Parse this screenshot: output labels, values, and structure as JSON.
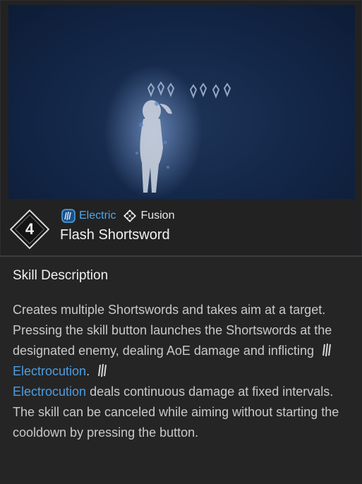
{
  "skill": {
    "level": "4",
    "name": "Flash Shortsword",
    "tags": [
      {
        "label": "Electric",
        "icon": "electric-icon",
        "color": "#4fa6ea"
      },
      {
        "label": "Fusion",
        "icon": "fusion-icon",
        "color": "#e8e8e8"
      }
    ]
  },
  "description": {
    "title": "Skill Description",
    "p1_a": "Creates multiple Shortswords and takes aim at a target. Pressing the skill button launches the Shortswords at the designated enemy, dealing AoE damage and inflicting",
    "kw1": "Electrocution",
    "p1_b": ".",
    "kw2": "Electrocution",
    "p1_c": " deals continuous damage at fixed intervals.",
    "p2": "The skill can be canceled while aiming without starting the cooldown by pressing the button."
  },
  "colors": {
    "keyword": "#4f9de0",
    "electric": "#4fa6ea",
    "background": "#222223"
  }
}
